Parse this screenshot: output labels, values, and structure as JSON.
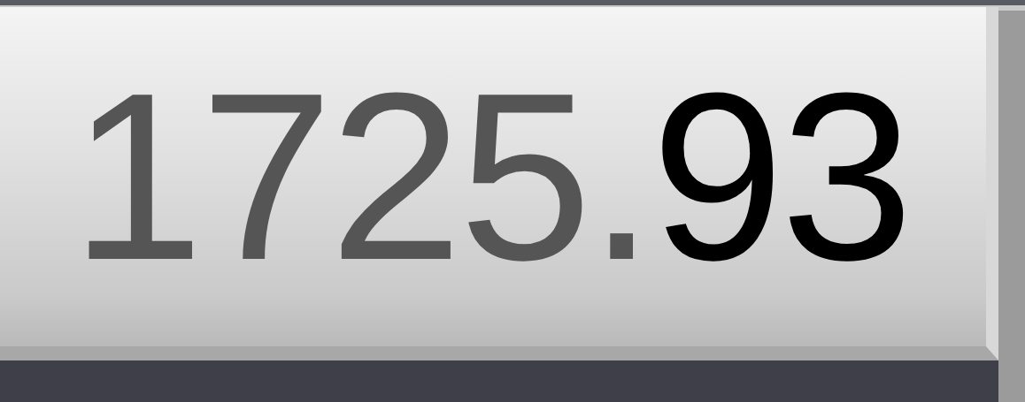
{
  "display": {
    "segments": [
      {
        "text": "1725.",
        "dimmed": true
      },
      {
        "text": "93",
        "dimmed": false
      }
    ]
  }
}
